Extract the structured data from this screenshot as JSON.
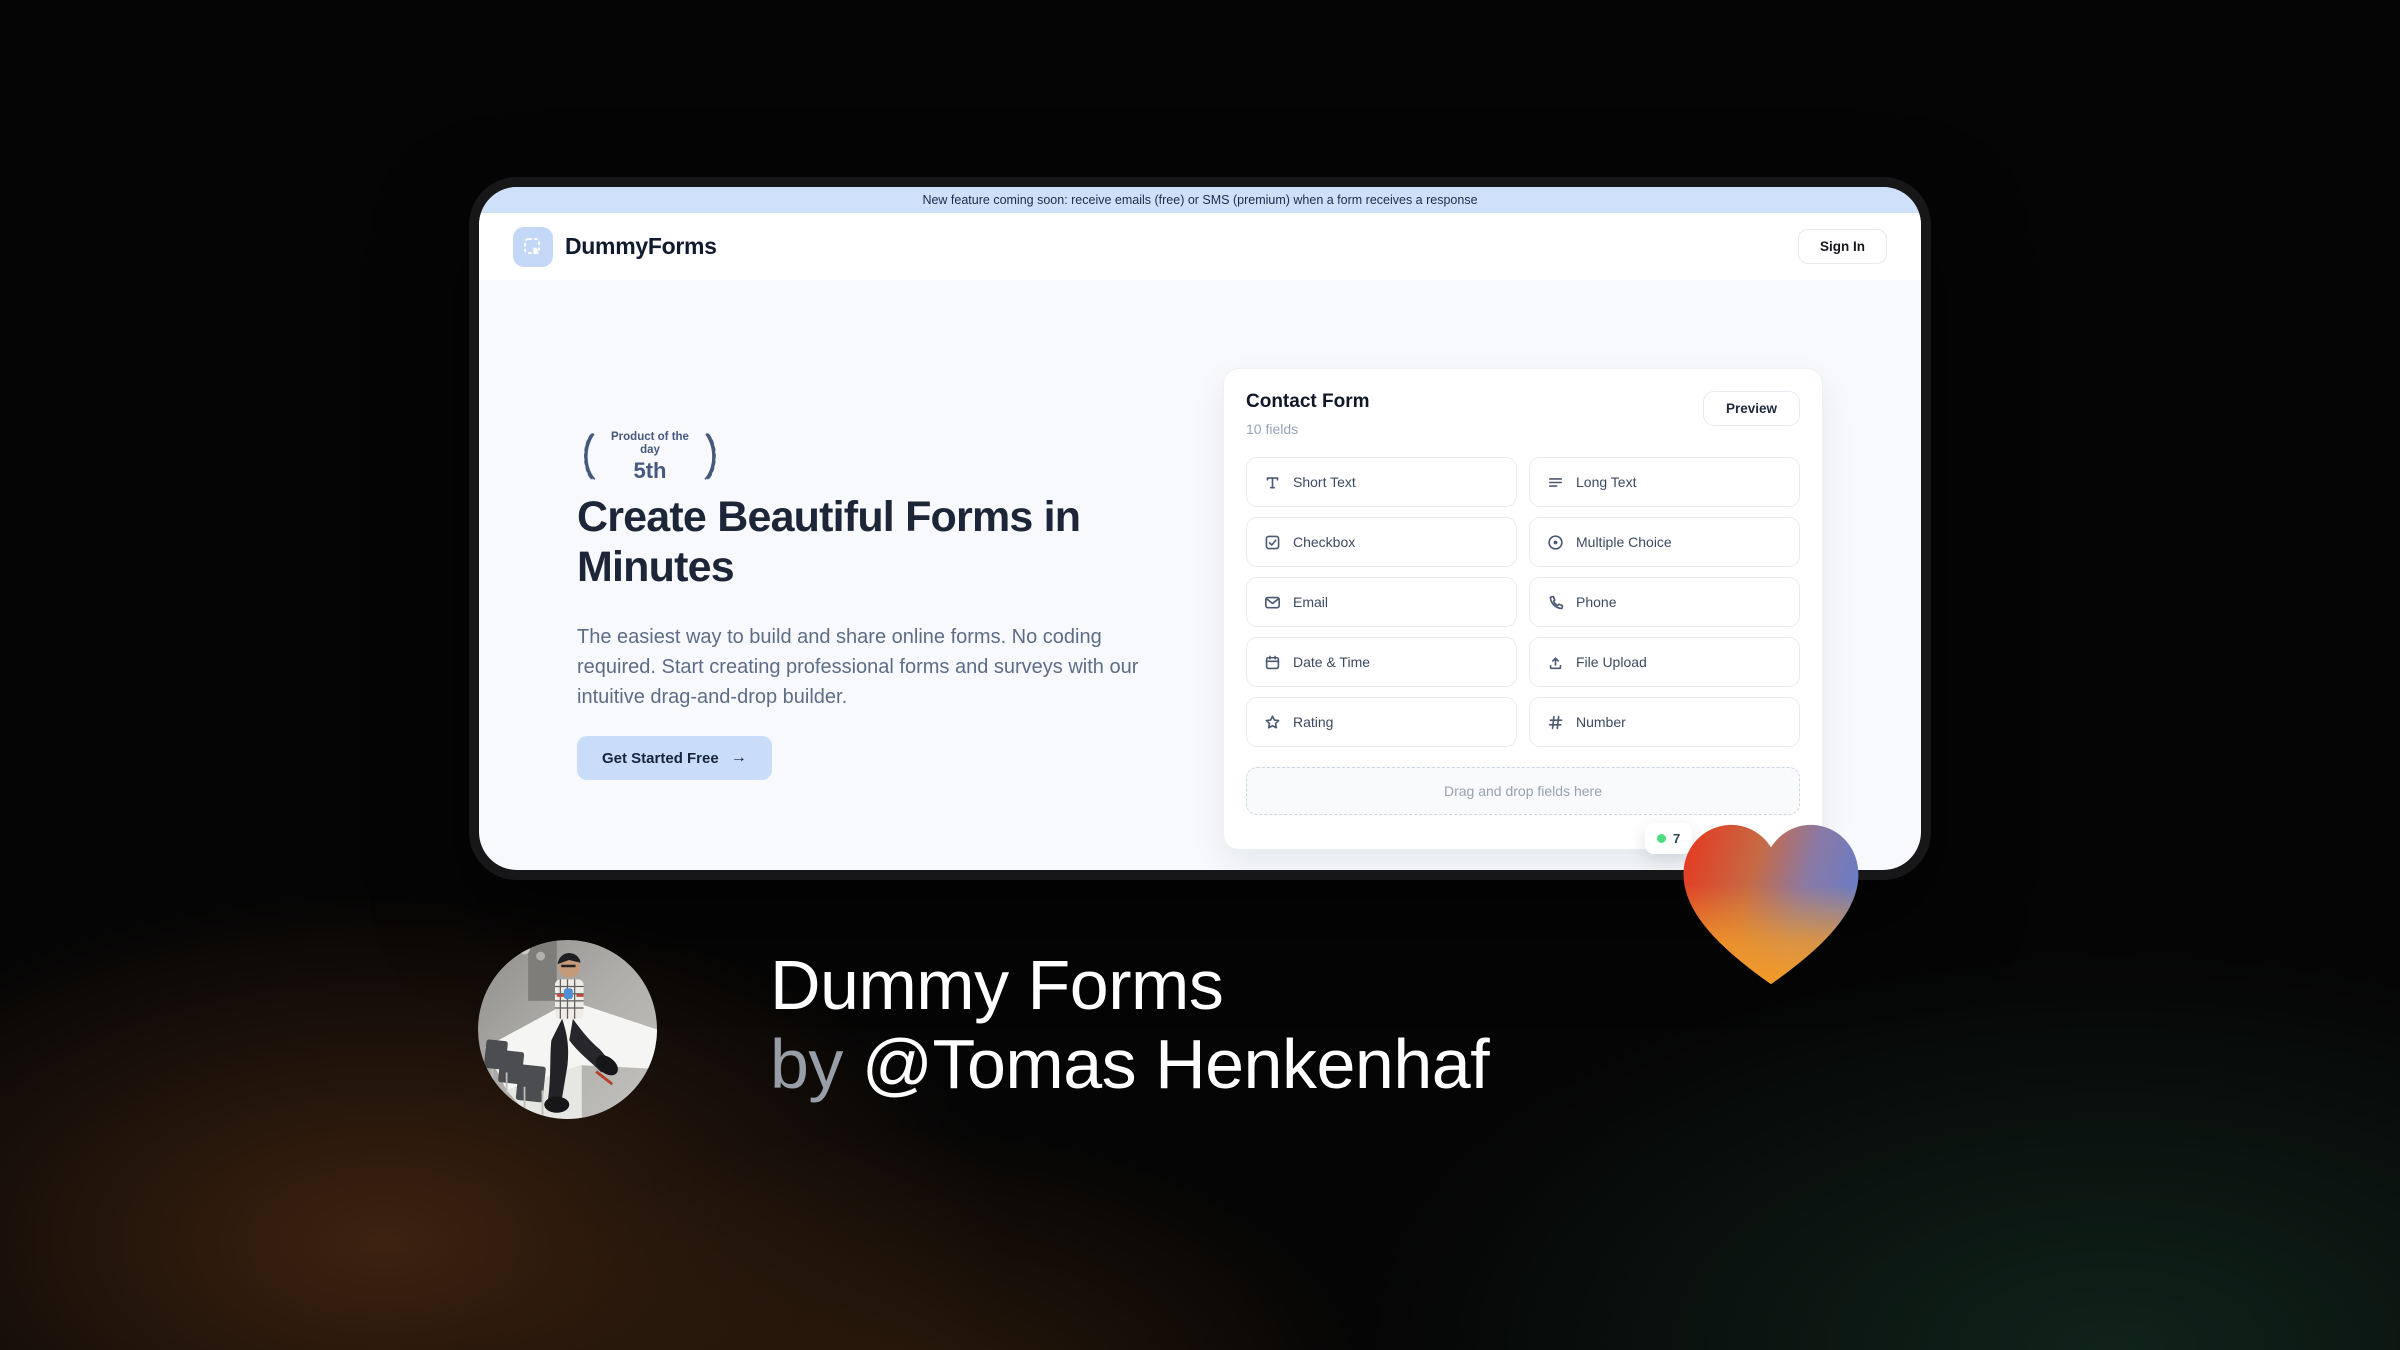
{
  "window": {
    "banner_text": "New feature coming soon: receive emails (free) or SMS (premium) when a form receives a response",
    "header": {
      "brand": "DummyForms",
      "sign_in": "Sign In"
    },
    "hero": {
      "award_line1": "Product of the day",
      "award_line2": "5th",
      "title": "Create Beautiful Forms in Minutes",
      "description": "The easiest way to build and share online forms. No coding required. Start creating professional forms and surveys with our intuitive drag-and-drop builder.",
      "cta": "Get Started Free",
      "cta_arrow": "→"
    },
    "builder": {
      "title": "Contact Form",
      "field_count": "10 fields",
      "preview": "Preview",
      "fields": [
        {
          "label": "Short Text",
          "icon": "short-text-icon"
        },
        {
          "label": "Long Text",
          "icon": "long-text-icon"
        },
        {
          "label": "Checkbox",
          "icon": "checkbox-icon"
        },
        {
          "label": "Multiple Choice",
          "icon": "circle-dot-icon"
        },
        {
          "label": "Email",
          "icon": "envelope-icon"
        },
        {
          "label": "Phone",
          "icon": "phone-icon"
        },
        {
          "label": "Date & Time",
          "icon": "calendar-icon"
        },
        {
          "label": "File Upload",
          "icon": "upload-icon"
        },
        {
          "label": "Rating",
          "icon": "star-icon"
        },
        {
          "label": "Number",
          "icon": "hash-icon"
        }
      ],
      "dropzone": "Drag and drop fields here",
      "live_badge": "7"
    }
  },
  "caption": {
    "line1": "Dummy Forms",
    "by": "by",
    "author": "@Tomas Henkenhaf"
  },
  "colors": {
    "banner_blue": "#cfe0fa",
    "accent_blue": "#c9dcf9",
    "ink": "#1c2638",
    "muted_text": "#5d6d87",
    "green_dot": "#4ade80",
    "heart_red": "#e23a22",
    "heart_orange": "#f29d2b",
    "heart_blue": "#6b7cc4"
  }
}
